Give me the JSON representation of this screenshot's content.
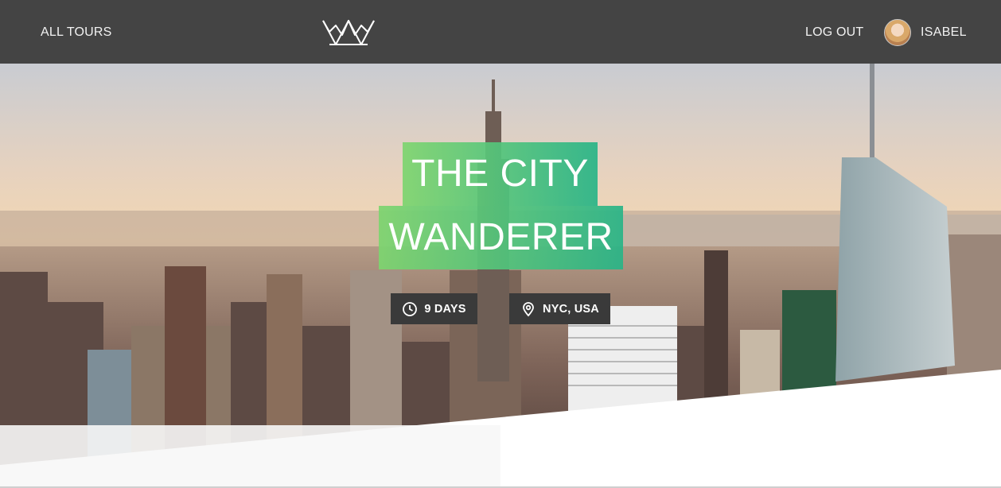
{
  "header": {
    "all_tours": "ALL TOURS",
    "logout": "LOG OUT",
    "user_name": "ISABEL",
    "logo_icon": "crown-outline-icon",
    "background": "#444444"
  },
  "hero": {
    "title_line1": "THE CITY",
    "title_line2": "WANDERER",
    "days_icon": "clock-icon",
    "days": "9 DAYS",
    "location_icon": "map-pin-icon",
    "location": "NYC, USA",
    "accent_from": "#7dd56f",
    "accent_to": "#28b487"
  }
}
